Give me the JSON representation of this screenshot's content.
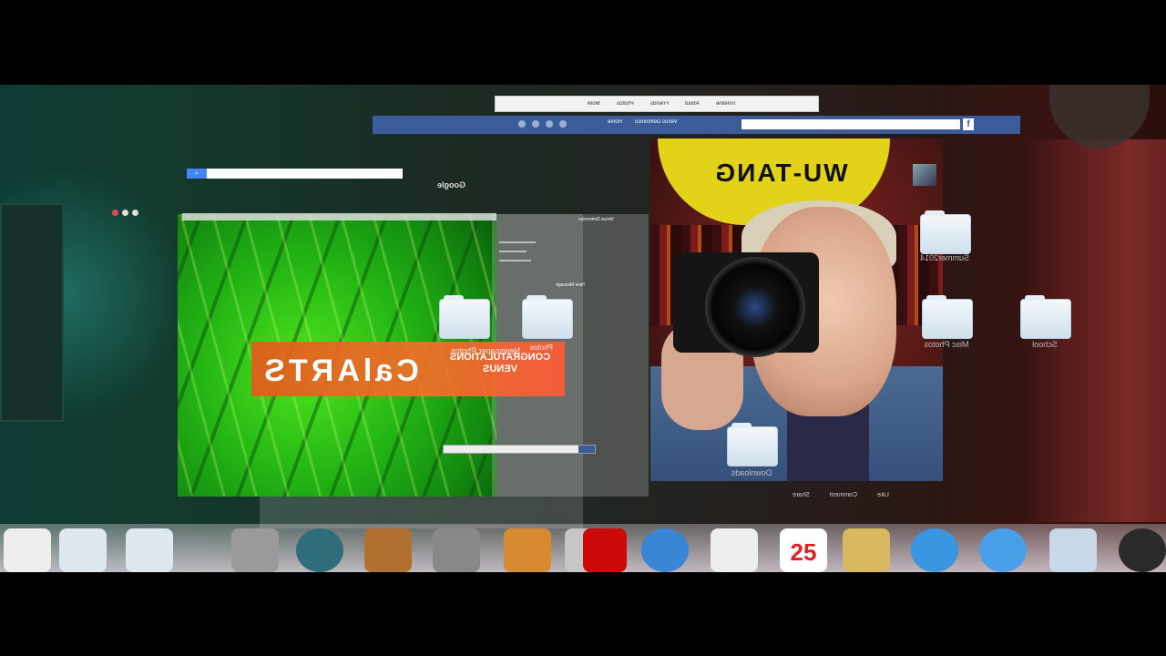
{
  "facebook": {
    "tabs": [
      "Timeline",
      "About",
      "Friends",
      "Photos",
      "More"
    ],
    "profile_name": "Venus Delmonico",
    "nav_home": "Home",
    "logo": "f",
    "actions": {
      "like": "Like",
      "comment": "Comment",
      "share": "Share"
    },
    "chat_name": "Venus Delmonico"
  },
  "google": {
    "logo": "Google",
    "search_icon": "search-icon"
  },
  "gmail": {
    "compose": "New Message",
    "header": "Venus Delmonico"
  },
  "calarts": {
    "logo": "CalARTS",
    "headline": "CONGRATULATIONS VENUS",
    "sub": "Newspaper Photos",
    "photos_label": "Photos"
  },
  "photo": {
    "band_text": "WU-TANG"
  },
  "desktop_folders": [
    {
      "label": "Summer2014"
    },
    {
      "label": "Misc Photos"
    },
    {
      "label": "School"
    },
    {
      "label": "Downloads"
    }
  ],
  "dock": {
    "calendar_day": "25",
    "icons": [
      "disk-utility-icon",
      "folder-icon",
      "folder-icon",
      "system-preferences-icon",
      "time-machine-icon",
      "guitar-icon",
      "imovie-icon",
      "iphoto-icon",
      "photo-booth-icon",
      "photos-icon",
      "itunes-icon",
      "contacts-icon",
      "calendar-icon",
      "notes-icon",
      "app-store-icon",
      "safari-icon",
      "preview-icon",
      "dashboard-icon"
    ]
  },
  "colors": {
    "facebook_blue": "#3b5b99",
    "grass_green": "#22b314",
    "calarts_orange": "#f26f2a",
    "wutang_yellow": "#e3d21a",
    "google_blue": "#4285f4"
  }
}
